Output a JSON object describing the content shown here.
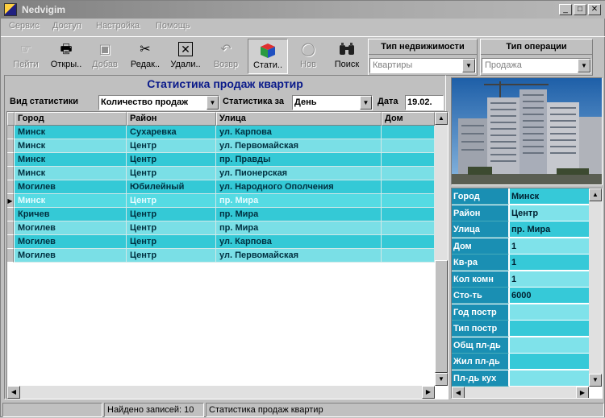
{
  "window": {
    "title": "Nedvigim"
  },
  "menu": [
    "Сервис",
    "Доступ",
    "Настройка",
    "Помощь"
  ],
  "toolbar": {
    "buttons": [
      {
        "label": "Пейти",
        "icon": "pointer-hand-icon",
        "enabled": false
      },
      {
        "label": "Откры..",
        "icon": "printer-icon",
        "enabled": true
      },
      {
        "label": "Добав",
        "icon": "add-document-icon",
        "enabled": false
      },
      {
        "label": "Редак..",
        "icon": "scissors-icon",
        "enabled": true
      },
      {
        "label": "Удали..",
        "icon": "delete-x-icon",
        "enabled": true
      },
      {
        "label": "Возвр",
        "icon": "undo-icon",
        "enabled": false
      },
      {
        "label": "Стати..",
        "icon": "statistics-cube-icon",
        "enabled": true,
        "active": true
      },
      {
        "label": "Нов",
        "icon": "refresh-icon",
        "enabled": false
      },
      {
        "label": "Поиск",
        "icon": "binoculars-icon",
        "enabled": true
      }
    ],
    "property_type": {
      "label": "Тип недвижимости",
      "value": "Квартиры"
    },
    "operation_type": {
      "label": "Тип операции",
      "value": "Продажа"
    }
  },
  "stats": {
    "title": "Статистика продаж квартир",
    "view_label": "Вид статистики",
    "view_value": "Количество продаж",
    "period_label": "Статистика за",
    "period_value": "День",
    "date_label": "Дата",
    "date_value": "19.02."
  },
  "grid": {
    "columns": [
      "Город",
      "Район",
      "Улица",
      "Дом"
    ],
    "rows": [
      [
        "Минск",
        "Сухаревка",
        "ул. Карпова",
        ""
      ],
      [
        "Минск",
        "Центр",
        "ул. Первомайская",
        ""
      ],
      [
        "Минск",
        "Центр",
        "пр. Правды",
        ""
      ],
      [
        "Минск",
        "Центр",
        "ул. Пионерская",
        ""
      ],
      [
        "Могилев",
        "Юбилейный",
        "ул. Народного Ополчения",
        ""
      ],
      [
        "Минск",
        "Центр",
        "пр. Мира",
        ""
      ],
      [
        "Кричев",
        "Центр",
        "пр. Мира",
        ""
      ],
      [
        "Могилев",
        "Центр",
        "пр. Мира",
        ""
      ],
      [
        "Могилев",
        "Центр",
        "ул. Карпова",
        ""
      ],
      [
        "Могилев",
        "Центр",
        "ул. Первомайская",
        ""
      ]
    ],
    "selected_row": 5
  },
  "details": [
    {
      "label": "Город",
      "value": "Минск"
    },
    {
      "label": "Район",
      "value": "Центр"
    },
    {
      "label": "Улица",
      "value": "пр. Мира"
    },
    {
      "label": "Дом",
      "value": "1"
    },
    {
      "label": "Кв-ра",
      "value": "1"
    },
    {
      "label": "Кол комн",
      "value": "1"
    },
    {
      "label": "Сто-ть",
      "value": "6000"
    },
    {
      "label": "Год постр",
      "value": ""
    },
    {
      "label": "Тип постр",
      "value": ""
    },
    {
      "label": "Общ пл-дь",
      "value": ""
    },
    {
      "label": "Жил пл-дь",
      "value": ""
    },
    {
      "label": "Пл-дь кух",
      "value": ""
    }
  ],
  "status": {
    "records": "Найдено записей: 10",
    "message": "Статистика продаж квартир"
  },
  "colors": {
    "row_dark": "#34c9d6",
    "row_light": "#7adfe6",
    "detail_label": "#1a8fb3",
    "title_blue": "#0a1a8a"
  }
}
